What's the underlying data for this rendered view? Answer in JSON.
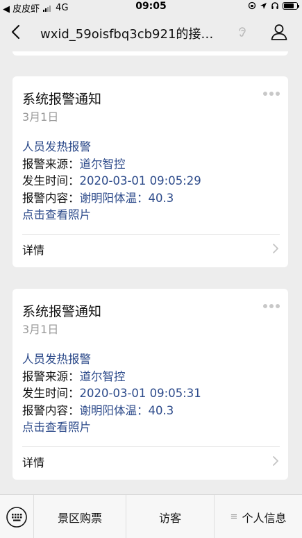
{
  "status_bar": {
    "carrier": "◀ 皮皮虾",
    "network": "4G",
    "time": "09:05"
  },
  "nav": {
    "title": "wxid_59oisfbq3cb921的接…"
  },
  "cards": [
    {
      "title": "系统报警通知",
      "date": "3月1日",
      "alert_type": "人员发热报警",
      "source_label": "报警来源：",
      "source_value": "道尔智控",
      "time_label": "发生时间：",
      "time_value": "2020-03-01 09:05:29",
      "content_label": "报警内容：",
      "content_value": "谢明阳体温：40.3",
      "photo_link": "点击查看照片",
      "detail_label": "详情"
    },
    {
      "title": "系统报警通知",
      "date": "3月1日",
      "alert_type": "人员发热报警",
      "source_label": "报警来源：",
      "source_value": "道尔智控",
      "time_label": "发生时间：",
      "time_value": "2020-03-01 09:05:31",
      "content_label": "报警内容：",
      "content_value": "谢明阳体温：40.3",
      "photo_link": "点击查看照片",
      "detail_label": "详情"
    }
  ],
  "bottom_menu": {
    "items": [
      "景区购票",
      "访客",
      "个人信息"
    ],
    "menu_icon": "≡"
  },
  "colors": {
    "background": "#ededed",
    "link_blue": "#2c4a8a",
    "muted": "#999999"
  }
}
